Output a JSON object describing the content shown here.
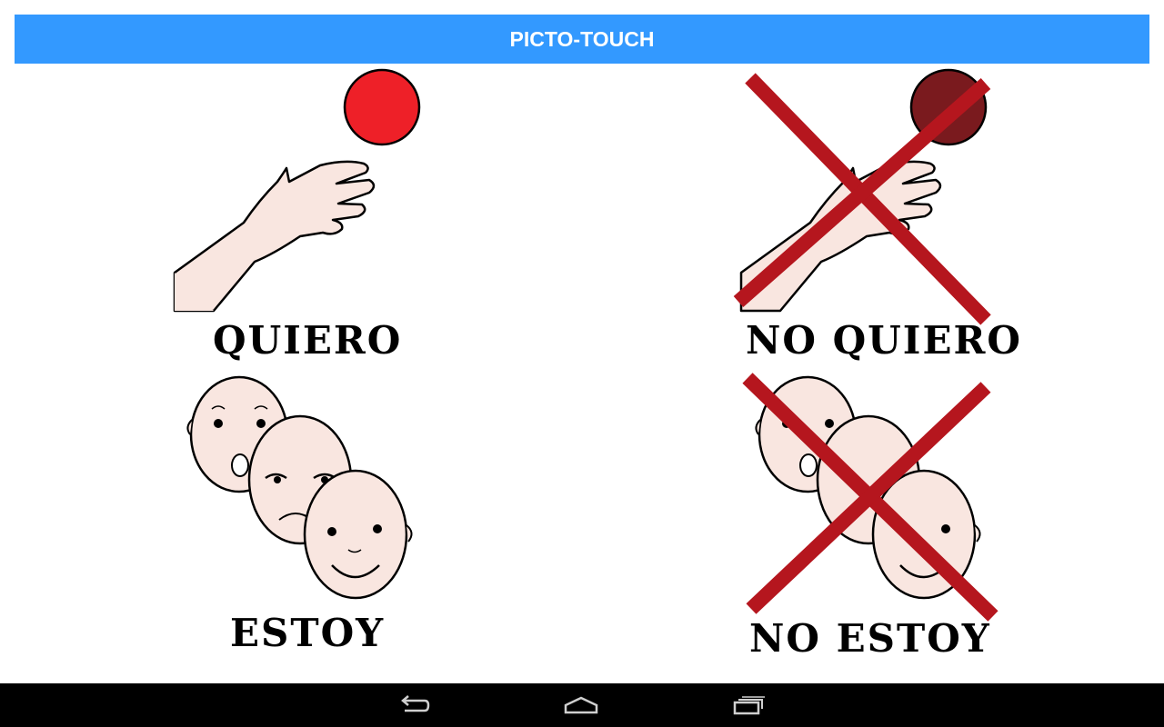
{
  "app_bar": {
    "title": "PICTO-TOUCH"
  },
  "colors": {
    "app_bar": "#3399ff",
    "ball": "#ee2028",
    "ball_dark": "#7a1a1e",
    "cross": "#b5161e",
    "skin": "#f9e6e0",
    "nav_bar": "#000000"
  },
  "pictograms": [
    {
      "label": "QUIERO",
      "image": "hand-reaching-ball",
      "crossed": false
    },
    {
      "label": "NO QUIERO",
      "image": "hand-reaching-ball",
      "crossed": true
    },
    {
      "label": "ESTOY",
      "image": "three-faces",
      "crossed": false
    },
    {
      "label": "NO ESTOY",
      "image": "three-faces",
      "crossed": true
    }
  ],
  "nav_bar": {
    "buttons": [
      "back-icon",
      "home-icon",
      "recents-icon"
    ]
  }
}
